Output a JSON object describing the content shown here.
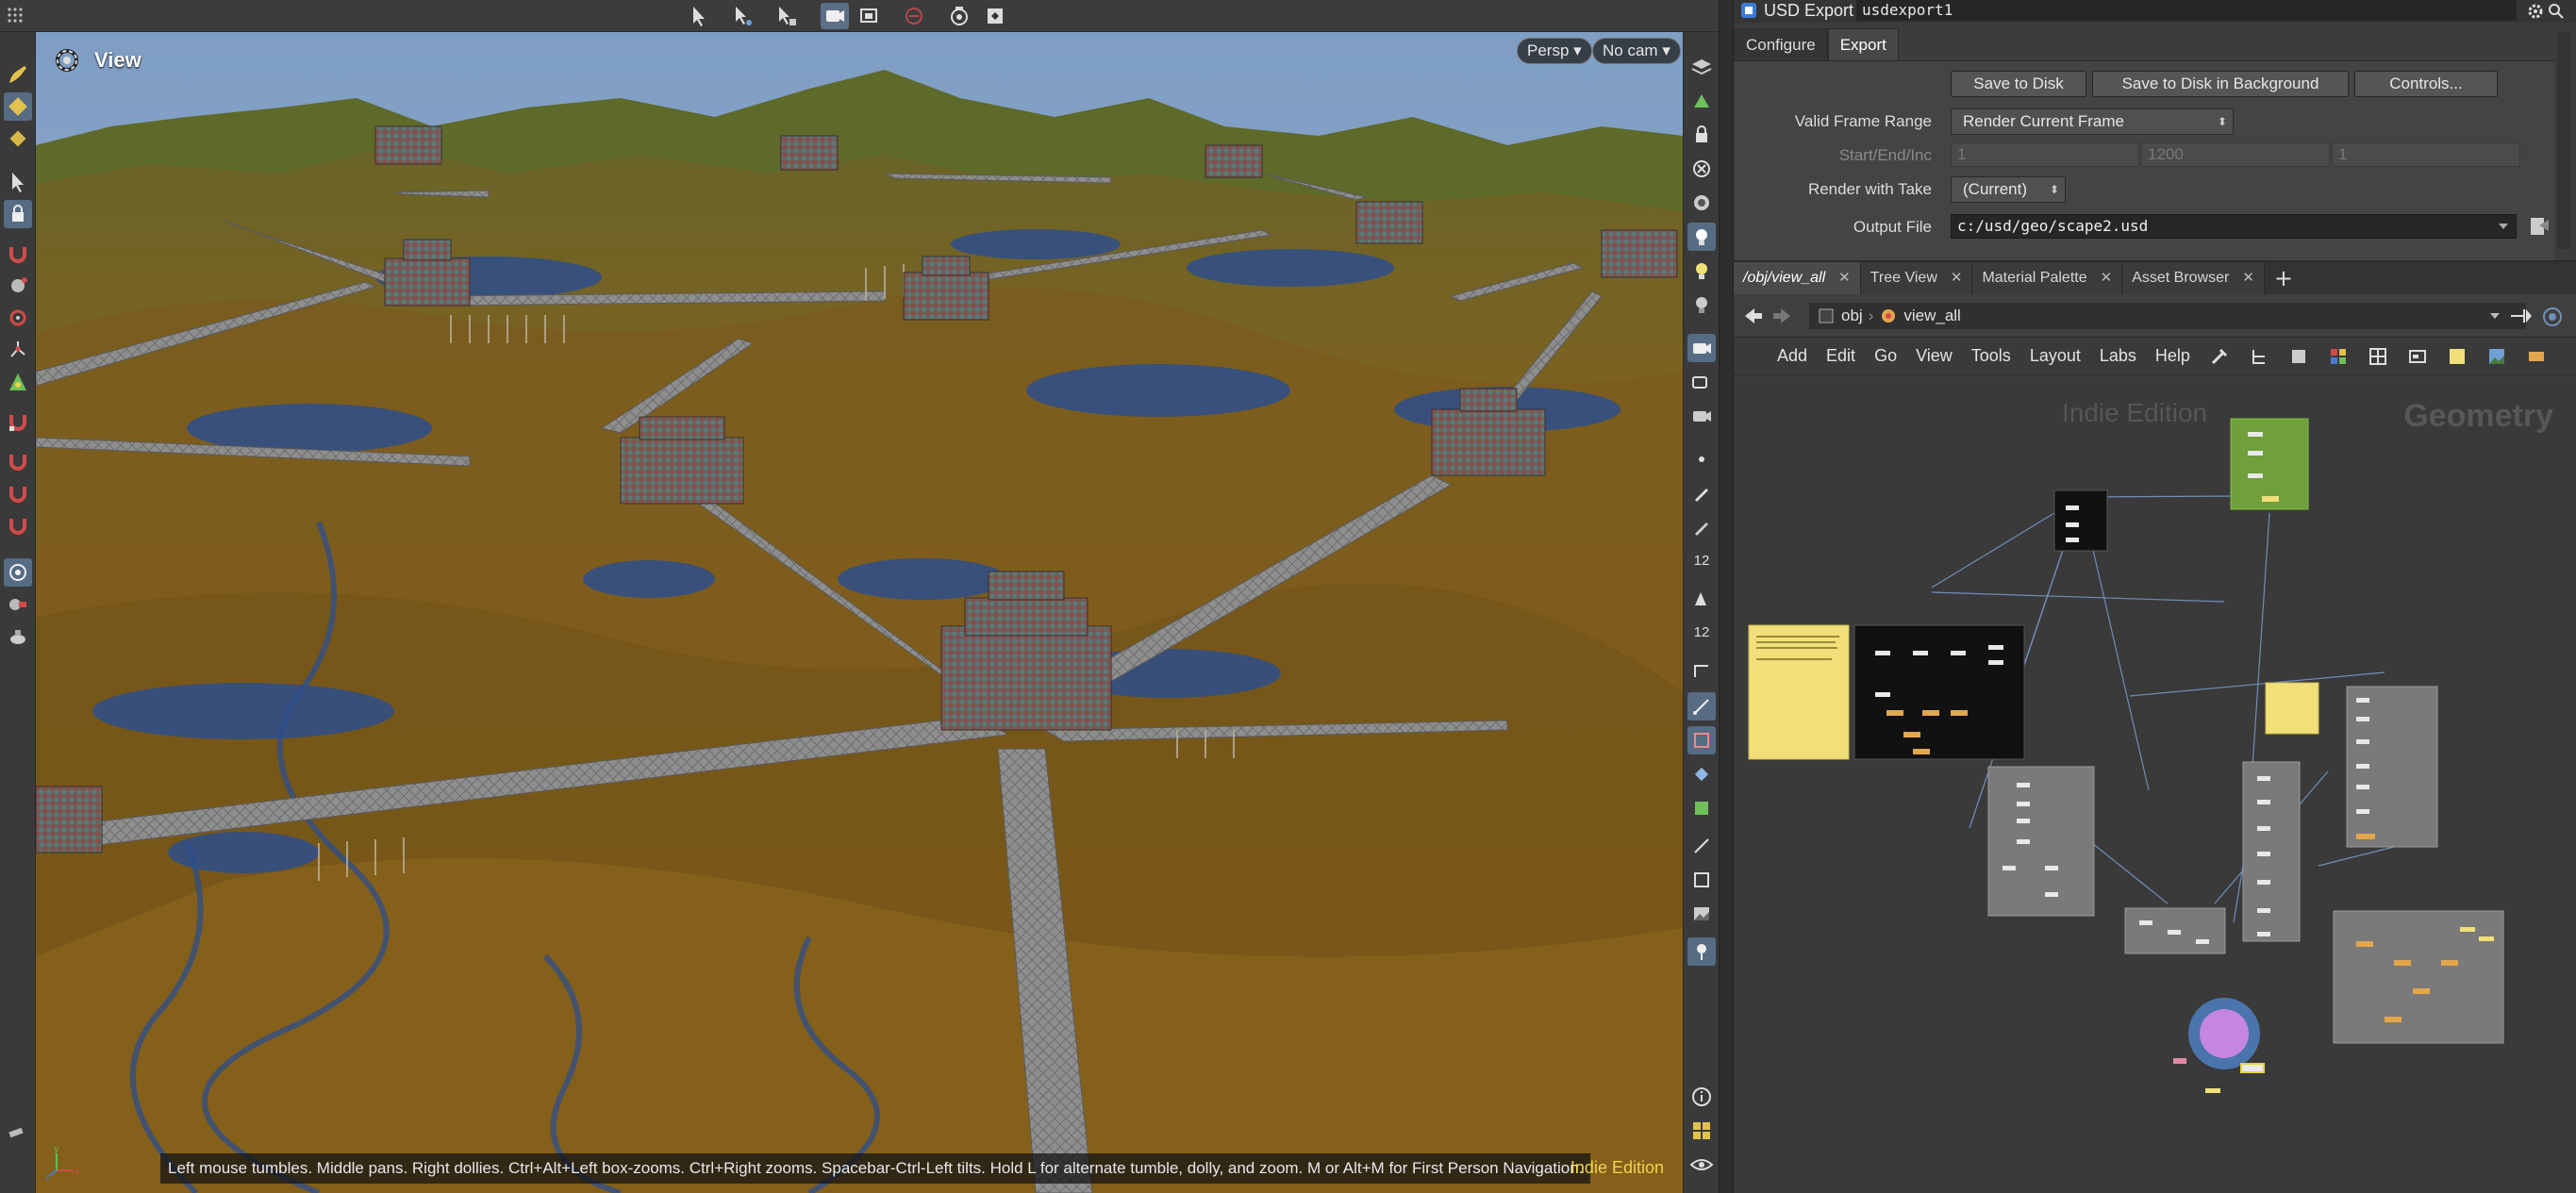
{
  "viewport": {
    "title": "View",
    "camera_mode": "Persp",
    "camera": "No cam",
    "status": "Left mouse tumbles. Middle pans. Right dollies. Ctrl+Alt+Left box-zooms. Ctrl+Right zooms. Spacebar-Ctrl-Left tilts. Hold L for alternate tumble, dolly, and zoom. M or Alt+M for First Person Navigation.",
    "edition_badge": "Indie Edition",
    "axis": {
      "x": "x",
      "y": "y",
      "z": "z"
    }
  },
  "right_shelf": {
    "label_12a": "12",
    "label_12b": "12"
  },
  "param_pane": {
    "node_type": "USD Export",
    "node_name": "usdexport1",
    "tabs": [
      "Configure",
      "Export"
    ],
    "active_tab": "Export",
    "buttons": {
      "save_to_disk": "Save to Disk",
      "save_bg": "Save to Disk in Background",
      "controls": "Controls..."
    },
    "valid_frame_range": {
      "label": "Valid Frame Range",
      "value": "Render Current Frame"
    },
    "start_end_inc": {
      "label": "Start/End/Inc",
      "values": [
        "1",
        "1200",
        "1"
      ]
    },
    "render_with_take": {
      "label": "Render with Take",
      "value": "(Current)"
    },
    "output_file": {
      "label": "Output File",
      "value": "c:/usd/geo/scape2.usd"
    }
  },
  "network": {
    "tabs": [
      {
        "label": "/obj/view_all",
        "active": true
      },
      {
        "label": "Tree View"
      },
      {
        "label": "Material Palette"
      },
      {
        "label": "Asset Browser"
      }
    ],
    "path": [
      "obj",
      "view_all"
    ],
    "menu": [
      "Add",
      "Edit",
      "Go",
      "View",
      "Tools",
      "Layout",
      "Labs",
      "Help"
    ],
    "watermark": "Indie Edition",
    "context_label": "Geometry"
  },
  "colors": {
    "accent": "#566b84",
    "indie": "#f2d34a",
    "terrain": "#7a5d1e",
    "water": "#2d4e8c",
    "sky": "#8aa7c9"
  }
}
